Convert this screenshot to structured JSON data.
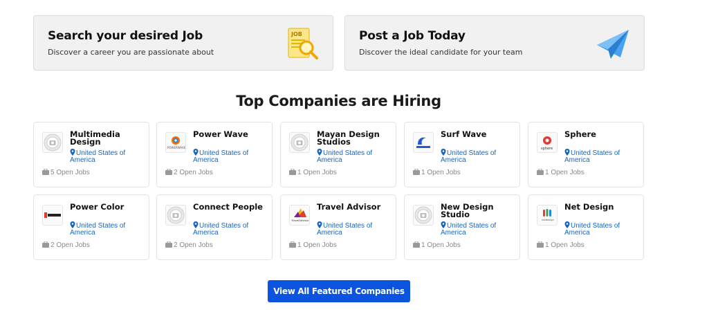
{
  "promos": [
    {
      "title": "Search your desired Job",
      "subtitle": "Discover a career you are passionate about",
      "icon": "job-search-icon"
    },
    {
      "title": "Post a Job Today",
      "subtitle": "Discover the ideal candidate for your team",
      "icon": "paper-plane-icon"
    }
  ],
  "section_title": "Top Companies are Hiring",
  "companies": [
    {
      "name": "Multimedia Design",
      "location": "United States of America",
      "jobs": "5 Open Jobs",
      "logo": "placeholder-logo"
    },
    {
      "name": "Power Wave",
      "location": "United States of America",
      "jobs": "2 Open Jobs",
      "logo": "power-wave-logo"
    },
    {
      "name": "Mayan Design Studios",
      "location": "United States of America",
      "jobs": "1 Open Jobs",
      "logo": "placeholder-logo"
    },
    {
      "name": "Surf Wave",
      "location": "United States of America",
      "jobs": "1 Open Jobs",
      "logo": "surf-wave-logo"
    },
    {
      "name": "Sphere",
      "location": "United States of America",
      "jobs": "1 Open Jobs",
      "logo": "sphere-logo"
    },
    {
      "name": "Power Color",
      "location": "United States of America",
      "jobs": "2 Open Jobs",
      "logo": "power-color-logo"
    },
    {
      "name": "Connect People",
      "location": "United States of America",
      "jobs": "2 Open Jobs",
      "logo": "placeholder-logo"
    },
    {
      "name": "Travel Advisor",
      "location": "United States of America",
      "jobs": "1 Open Jobs",
      "logo": "travel-advisor-logo"
    },
    {
      "name": "New Design Studio",
      "location": "United States of America",
      "jobs": "1 Open Jobs",
      "logo": "placeholder-logo"
    },
    {
      "name": "Net Design",
      "location": "United States of America",
      "jobs": "1 Open Jobs",
      "logo": "net-design-logo"
    }
  ],
  "view_all_label": "View All Featured Companies",
  "colors": {
    "accent": "#0a54e0",
    "location": "#1565c0",
    "muted": "#888888"
  }
}
